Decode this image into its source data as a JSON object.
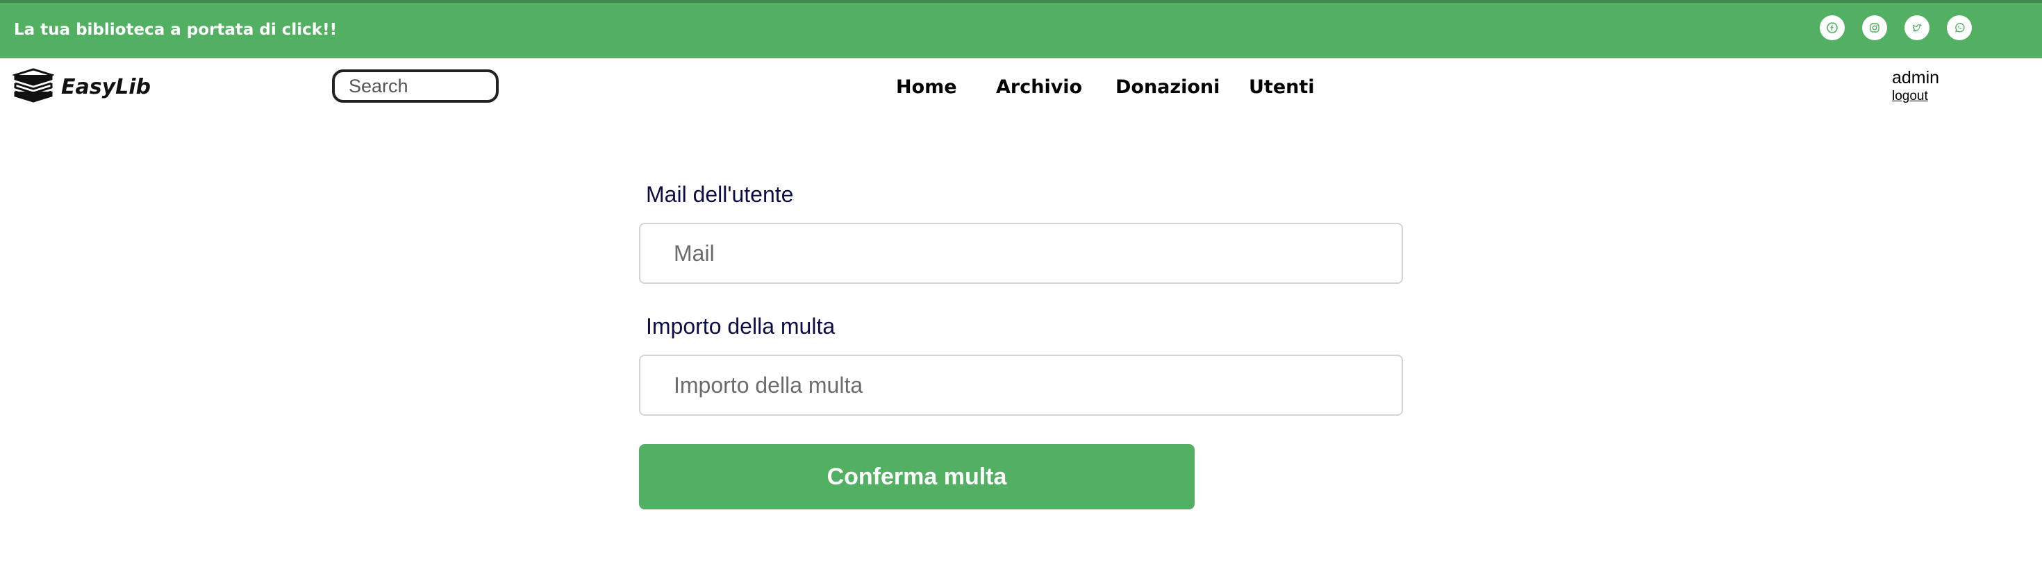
{
  "topbar": {
    "tagline": "La tua biblioteca a portata di click!!",
    "socials": [
      {
        "icon": "facebook-icon"
      },
      {
        "icon": "instagram-icon"
      },
      {
        "icon": "twitter-icon"
      },
      {
        "icon": "whatsapp-icon"
      }
    ]
  },
  "header": {
    "logo_text": "EasyLib",
    "logo_icon": "books-icon",
    "search_placeholder": "Search",
    "nav": [
      "Home",
      "Archivio",
      "Donazioni",
      "Utenti"
    ],
    "user": "admin",
    "logout": "logout"
  },
  "form": {
    "mail_label": "Mail dell'utente",
    "mail_placeholder": "Mail",
    "amount_label": "Importo della multa",
    "amount_placeholder": "Importo della multa",
    "submit_label": "Conferma multa"
  },
  "colors": {
    "accent": "#52b062",
    "label_text": "#0d0d45"
  }
}
